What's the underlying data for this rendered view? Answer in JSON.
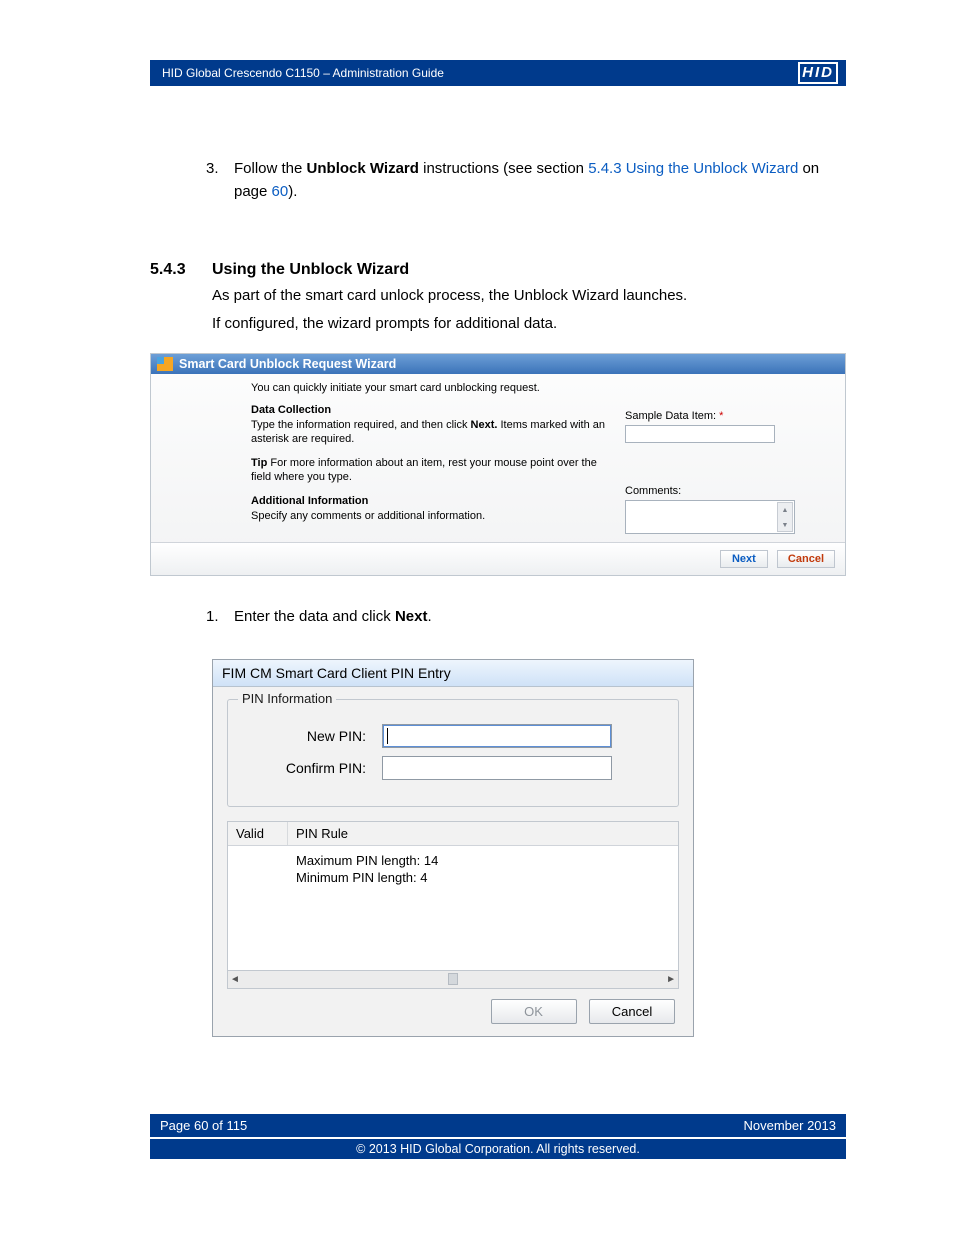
{
  "header": {
    "title": "HID Global Crescendo C1150  – Administration Guide",
    "logo_text": "HID"
  },
  "body": {
    "step3_num": "3.",
    "step3_pre": "Follow the ",
    "step3_bold": "Unblock Wizard",
    "step3_mid": " instructions (see section ",
    "step3_link": "5.4.3 Using the Unblock Wizard",
    "step3_mid2": " on page ",
    "step3_pagelink": "60",
    "step3_post": ").",
    "section_num": "5.4.3",
    "section_title": "Using the Unblock Wizard",
    "para1": "As part of the smart card unlock process, the Unblock Wizard launches.",
    "para2": "If configured, the wizard prompts for additional data.",
    "step1_num": "1.",
    "step1_pre": "Enter the data and click ",
    "step1_bold": "Next",
    "step1_post": "."
  },
  "wizard1": {
    "title": "Smart Card Unblock Request Wizard",
    "intro": "You can quickly initiate your smart card unblocking request.",
    "dc_heading": "Data Collection",
    "dc_text_pre": "Type the information required, and then click ",
    "dc_text_bold": "Next.",
    "dc_text_post": " Items marked with an asterisk are required.",
    "tip_bold": "Tip",
    "tip_text": " For more information about an item, rest your mouse point over the field where you type.",
    "ai_heading": "Additional Information",
    "ai_text": "Specify any comments or additional information.",
    "sample_label": "Sample Data Item:",
    "comments_label": "Comments:",
    "next_btn": "Next",
    "cancel_btn": "Cancel"
  },
  "dlg": {
    "title": "FIM CM Smart Card Client PIN Entry",
    "group_legend": "PIN Information",
    "new_pin_label": "New PIN:",
    "confirm_pin_label": "Confirm PIN:",
    "col_valid": "Valid",
    "col_rule": "PIN Rule",
    "rule1": "Maximum PIN length: 14",
    "rule2": "Minimum PIN length: 4",
    "ok_btn": "OK",
    "cancel_btn": "Cancel"
  },
  "footer": {
    "page": "Page 60 of 115",
    "date": "November 2013",
    "copyright": "© 2013 HID Global Corporation. All rights reserved."
  }
}
